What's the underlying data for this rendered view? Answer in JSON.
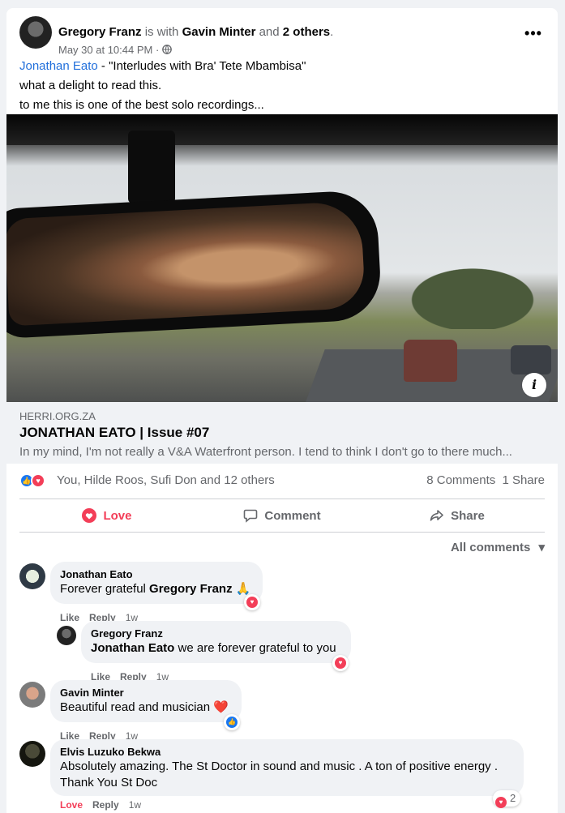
{
  "post": {
    "author": "Gregory Franz",
    "with_text": "is with",
    "tagged": "Gavin Minter",
    "and_text": "and",
    "others": "2 others",
    "period": ".",
    "timestamp": "May 30 at 10:44 PM",
    "dot": "·",
    "privacy_icon": "globe-icon",
    "more_icon": "more-icon",
    "more_label": "•••",
    "text": {
      "mention": "Jonathan Eato",
      "line1_rest": " - \"Interludes with Bra' Tete Mbambisa\"",
      "line2": "what a delight to read this.",
      "line3": "to me this is one of the best solo recordings..."
    }
  },
  "link_preview": {
    "domain": "HERRI.ORG.ZA",
    "title": "JONATHAN EATO | Issue #07",
    "description": "In my mind, I'm not really a V&A Waterfront person. I tend to think I don't go to there much...",
    "info_icon": "info-icon",
    "info_label": "i"
  },
  "reactions": {
    "names": "You, Hilde Roos, Sufi Don and 12 others",
    "comments": "8 Comments",
    "shares": "1 Share"
  },
  "actions": {
    "love": "Love",
    "comment": "Comment",
    "share": "Share"
  },
  "filter": {
    "label": "All comments",
    "icon": "▾"
  },
  "comments": [
    {
      "name": "Jonathan Eato",
      "text": "Forever grateful ",
      "mention": "Gregory Franz",
      "emoji": "🙏",
      "like": "Like",
      "reply": "Reply",
      "time": "1w"
    },
    {
      "name": "Gregory Franz",
      "mention": "Jonathan Eato",
      "text": " we are forever grateful to you",
      "like": "Like",
      "reply": "Reply",
      "time": "1w"
    },
    {
      "name": "Gavin Minter",
      "text": "Beautiful read and musician ",
      "emoji": "❤️",
      "like": "Like",
      "reply": "Reply",
      "time": "1w"
    },
    {
      "name": "Elvis Luzuko Bekwa",
      "text": "Absolutely amazing. The St Doctor in sound and music . A ton of positive energy . Thank You St Doc",
      "like": "Love",
      "reply": "Reply",
      "time": "1w",
      "reaction_count": "2"
    }
  ],
  "colors": {
    "accent_love": "#f33e58",
    "accent_like": "#1877f2",
    "link": "#216fdb",
    "muted": "#65676b",
    "bubble": "#f0f2f5"
  }
}
